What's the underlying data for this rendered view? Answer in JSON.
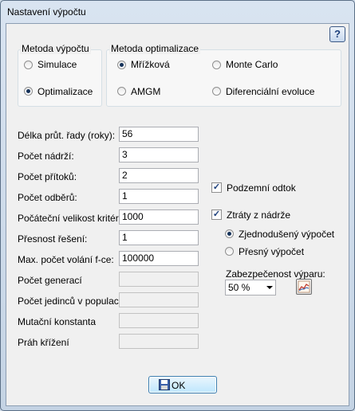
{
  "window": {
    "title": "Nastavení výpočtu",
    "help_label": "?"
  },
  "method_group": {
    "legend": "Metoda výpočtu",
    "options": [
      {
        "label": "Simulace",
        "checked": false
      },
      {
        "label": "Optimalizace",
        "checked": true
      }
    ]
  },
  "optim_group": {
    "legend": "Metoda optimalizace",
    "options": [
      {
        "label": "Mřížková",
        "checked": true
      },
      {
        "label": "Monte Carlo",
        "checked": false
      },
      {
        "label": "AMGM",
        "checked": false
      },
      {
        "label": "Diferenciální evoluce",
        "checked": false
      }
    ]
  },
  "fields": [
    {
      "label": "Délka průt. řady (roky):",
      "value": "56",
      "enabled": true
    },
    {
      "label": "Počet nádrží:",
      "value": "3",
      "enabled": true
    },
    {
      "label": "Počet přítoků:",
      "value": "2",
      "enabled": true
    },
    {
      "label": "Počet odběrů:",
      "value": "1",
      "enabled": true
    },
    {
      "label": "Počáteční velikost kritéria:",
      "value": "1000",
      "enabled": true
    },
    {
      "label": "Přesnost řešení:",
      "value": "1",
      "enabled": true
    },
    {
      "label": "Max. počet volání f-ce:",
      "value": "100000",
      "enabled": true
    },
    {
      "label": "Počet generací",
      "value": "",
      "enabled": false
    },
    {
      "label": "Počet jedinců v populaci",
      "value": "",
      "enabled": false
    },
    {
      "label": "Mutační konstanta",
      "value": "",
      "enabled": false
    },
    {
      "label": "Práh křížení",
      "value": "",
      "enabled": false
    }
  ],
  "right_panel": {
    "underground_outflow": {
      "label": "Podzemní odtok",
      "checked": true
    },
    "reservoir_losses": {
      "label": "Ztráty z nádrže",
      "checked": true
    },
    "loss_options": [
      {
        "label": "Zjednodušený výpočet",
        "checked": true
      },
      {
        "label": "Přesný výpočet",
        "checked": false
      }
    ],
    "evaporation": {
      "label": "Zabezpečenost výparu:",
      "value": "50 %"
    }
  },
  "ok_button": {
    "label": "OK"
  },
  "icons": {
    "ok": "floppy-disk-icon",
    "chart": "chart-icon",
    "help": "help-icon"
  }
}
